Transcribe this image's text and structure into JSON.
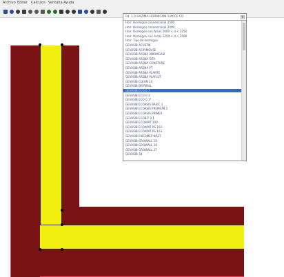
{
  "menu": {
    "items": [
      "Archivo",
      "Editar",
      "Calculos",
      "Ventana",
      "Ayuda"
    ]
  },
  "toolbar": {
    "buttons": [
      "new",
      "open",
      "save",
      "print",
      "cut",
      "copy",
      "paste",
      "undo",
      "redo",
      "zoom-in",
      "zoom-out",
      "zoom-fit",
      "draw-line",
      "draw-rect",
      "node",
      "measure",
      "help"
    ]
  },
  "dropdown": {
    "selected_value": "04. 1.0 HAZIMA HORMIGON 1/ACCE CO",
    "options": [
      "Horr. Hormigon convencional 2500",
      "Horr. Hormigon convencional 2400",
      "Horr. Hormigon con Arcos 2000 < d < 2250",
      "Horr. Hormigon con Arcos 2250 < d < 2500",
      "Horr. Tipo de hormigon",
      "GEVASIB ACUSTIK",
      "GEVASIB ACRYMOUSE",
      "GEVASIB ARENA ABRIMGASI",
      "GEVASIB ARENA SITA",
      "GEVASIB ARENA CONSTURE",
      "GEVASIB ARENA PT",
      "GEVASIB ARENA PLANTE",
      "GEVASIB ARENA PLAFLUT",
      "GEVASIB CLEAN 34",
      "GEVASIB DRYWALL",
      "GEVASIB ECO 0.7",
      "GEVASIB ECO 0.1",
      "GEVASIB ECO 0.1*",
      "GEVASIB ECOASIS BASIC 1",
      "GEVASIB ECOASIS PREMIUM 2",
      "GEVASIB ECOASIS PRIMER",
      "GEVASIB ECOBIT 0.1",
      "GEVASIB ECOAPAT 100",
      "GEVASIB ECOAPAT PS 102",
      "GEVASIB ECOAPAT PS 103",
      "GEVASIB ENCOMEP NAST",
      "GEVASIB GROWALL 16",
      "GEVASIB GROWALL 26",
      "GEVASIB GROWALL 37",
      "GEVASIB 38"
    ],
    "selected_index": 15
  },
  "colors": {
    "wall": "#7a1414",
    "insulation": "#f2ee10",
    "accent": "#ff4466",
    "selection": "#3569c6"
  }
}
